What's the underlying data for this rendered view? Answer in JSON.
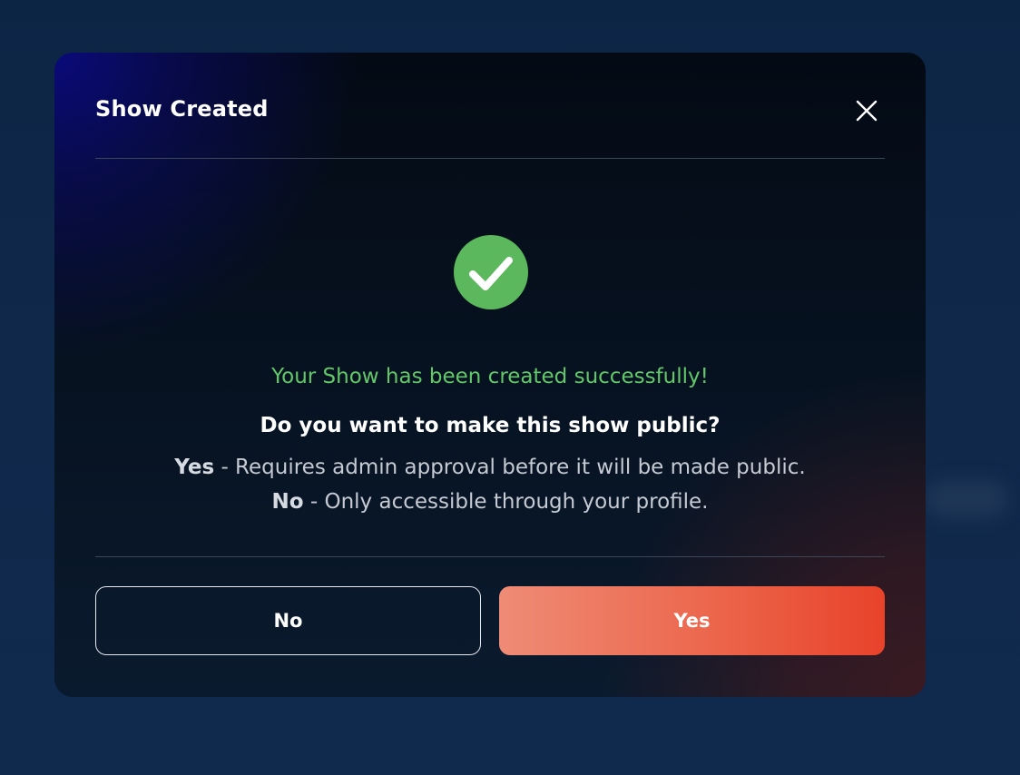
{
  "dialog": {
    "title": "Show Created",
    "close_icon": "close-icon",
    "status_icon": "check-circle-icon",
    "success_message": "Your Show has been created successfully!",
    "question": "Do you want to make this show public?",
    "yes_label": "Yes",
    "yes_description": " - Requires admin approval before it will be made public.",
    "no_label": "No",
    "no_description": " - Only accessible through your profile.",
    "buttons": {
      "no": "No",
      "yes": "Yes"
    }
  },
  "colors": {
    "success": "#63c76a",
    "check_circle": "#5cb85c",
    "primary_start": "#ef8b76",
    "primary_end": "#e8432a",
    "background": "#0f2748"
  }
}
